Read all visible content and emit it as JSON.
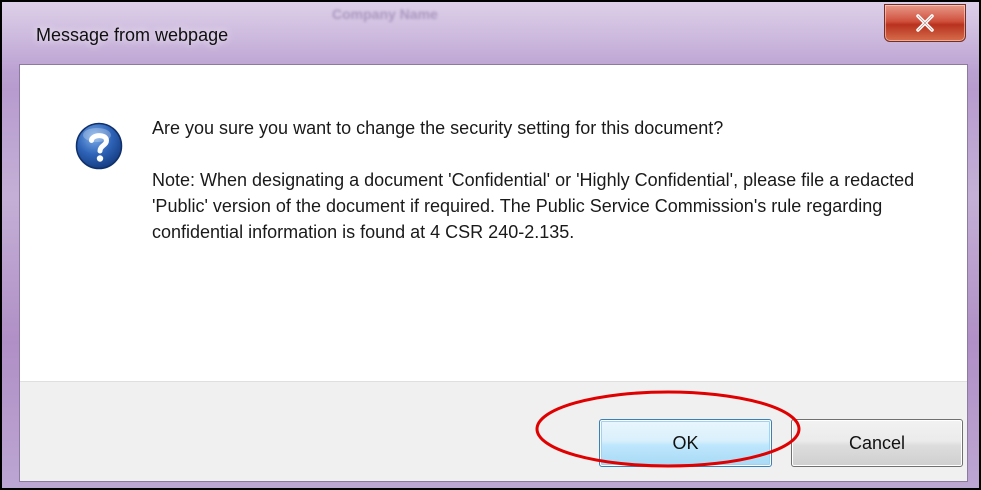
{
  "window": {
    "title": "Message from webpage",
    "background_title": "Company Name",
    "close_label": "X"
  },
  "dialog": {
    "icon": "question-icon",
    "question": "Are you sure you want to change the security setting for this document?",
    "note": "Note:  When designating a document 'Confidential' or 'Highly Confidential', please file a redacted 'Public' version of the document if required. The Public Service Commission's rule regarding confidential information is found at 4 CSR 240-2.135."
  },
  "buttons": {
    "ok_label": "OK",
    "cancel_label": "Cancel"
  },
  "colors": {
    "highlight": "#e00000",
    "close_button": "#c7432f",
    "frame": "#b79bcf"
  }
}
